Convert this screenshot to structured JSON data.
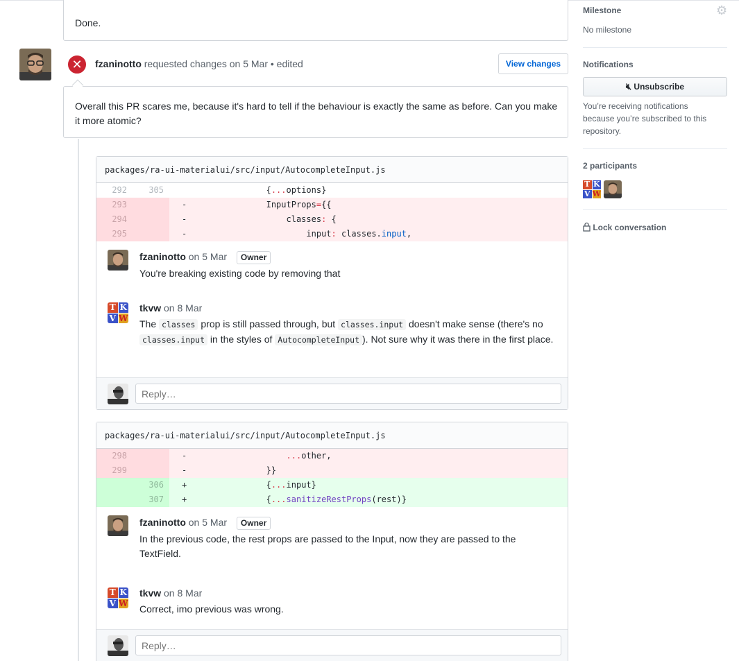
{
  "previous_comment": {
    "text": "Done."
  },
  "review": {
    "author": "fzaninotto",
    "action": "requested changes on 5 Mar • edited",
    "view_changes_label": "View changes",
    "body": "Overall this PR scares me, because it's hard to tell if the behaviour is exactly the same as before. Can you make it more atomic?"
  },
  "files": [
    {
      "path": "packages/ra-ui-materialui/src/input/AutocompleteInput.js",
      "rows": [
        {
          "type": "ctx",
          "old": "292",
          "new": "305",
          "mark": "",
          "code": "                {...options}"
        },
        {
          "type": "del",
          "old": "293",
          "new": "",
          "mark": "-",
          "code": "                InputProps={{"
        },
        {
          "type": "del",
          "old": "294",
          "new": "",
          "mark": "-",
          "code": "                    classes: {"
        },
        {
          "type": "del",
          "old": "295",
          "new": "",
          "mark": "-",
          "code": "                        input: classes.input,"
        }
      ],
      "comments": [
        {
          "author": "fzaninotto",
          "date": "on 5 Mar",
          "badge": "Owner",
          "body": "You're breaking existing code by removing that"
        },
        {
          "author": "tkvw",
          "date": "on 8 Mar",
          "badge": "",
          "body_parts": [
            "The ",
            "classes",
            " prop is still passed through, but ",
            "classes.input",
            " doesn't make sense (there's no ",
            "classes.input",
            " in the styles of ",
            "AutocompleteInput",
            "). Not sure why it was there in the first place."
          ]
        }
      ],
      "reply_placeholder": "Reply…"
    },
    {
      "path": "packages/ra-ui-materialui/src/input/AutocompleteInput.js",
      "rows": [
        {
          "type": "del",
          "old": "298",
          "new": "",
          "mark": "-",
          "code": "                    ...other,"
        },
        {
          "type": "del",
          "old": "299",
          "new": "",
          "mark": "-",
          "code": "                }}"
        },
        {
          "type": "add",
          "old": "",
          "new": "306",
          "mark": "+",
          "code": "                {...input}"
        },
        {
          "type": "add",
          "old": "",
          "new": "307",
          "mark": "+",
          "code": "                {...sanitizeRestProps(rest)}"
        }
      ],
      "comments": [
        {
          "author": "fzaninotto",
          "date": "on 5 Mar",
          "badge": "Owner",
          "body": "In the previous code, the rest props are passed to the Input, now they are passed to the TextField."
        },
        {
          "author": "tkvw",
          "date": "on 8 Mar",
          "badge": "",
          "body": "Correct, imo previous was wrong."
        }
      ],
      "reply_placeholder": "Reply…"
    }
  ],
  "sidebar": {
    "milestone_title": "Milestone",
    "milestone_value": "No milestone",
    "notifications_title": "Notifications",
    "unsubscribe_label": "Unsubscribe",
    "notifications_text": "You’re receiving notifications because you’re subscribed to this repository.",
    "participants_title": "2 participants",
    "lock_label": "Lock conversation"
  },
  "icons": {
    "gear": "gear-icon",
    "mute": "mute-icon",
    "lock": "lock-icon",
    "x": "x-icon"
  },
  "colors": {
    "link": "#0366d6",
    "danger": "#cb2431",
    "del_bg": "#ffeef0",
    "add_bg": "#e6ffed"
  }
}
